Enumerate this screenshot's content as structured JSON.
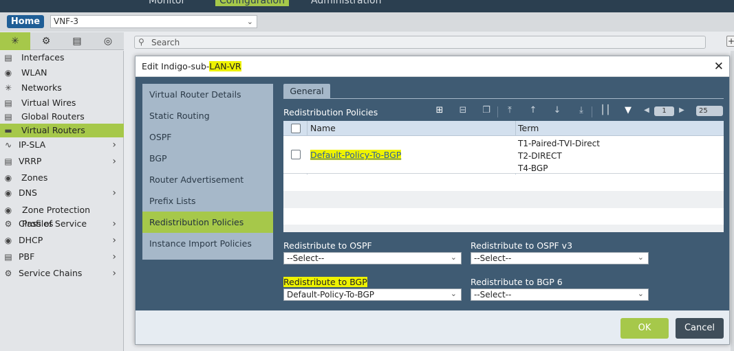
{
  "topnav": {
    "monitor": "Monitor",
    "configuration": "Configuration",
    "administration": "Administration"
  },
  "homebar": {
    "home": "Home",
    "appliance": "VNF-3"
  },
  "sidebar": {
    "items": [
      {
        "label": "Interfaces",
        "icon": "interfaces-icon"
      },
      {
        "label": "WLAN",
        "icon": "wlan-icon"
      },
      {
        "label": "Networks",
        "icon": "networks-icon"
      },
      {
        "label": "Virtual Wires",
        "icon": "virtual-wires-icon"
      },
      {
        "label": "Global Routers",
        "icon": "global-routers-icon"
      },
      {
        "label": "Virtual Routers",
        "icon": "virtual-routers-icon"
      },
      {
        "label": "IP-SLA",
        "icon": "ip-sla-icon"
      },
      {
        "label": "VRRP",
        "icon": "vrrp-icon"
      },
      {
        "label": "Zones",
        "icon": "zones-icon"
      },
      {
        "label": "DNS",
        "icon": "dns-icon"
      },
      {
        "label": "Zone Protection Profiles",
        "icon": "zone-protection-icon"
      },
      {
        "label": "Class of Service",
        "icon": "class-of-service-icon"
      },
      {
        "label": "DHCP",
        "icon": "dhcp-icon"
      },
      {
        "label": "PBF",
        "icon": "pbf-icon"
      },
      {
        "label": "Service Chains",
        "icon": "service-chains-icon"
      }
    ]
  },
  "search": {
    "placeholder": "Search"
  },
  "modal": {
    "title_prefix": "Edit Indigo-sub-",
    "title_highlight": "LAN-VR",
    "nav": [
      "Virtual Router Details",
      "Static Routing",
      "OSPF",
      "BGP",
      "Router Advertisement",
      "Prefix Lists",
      "Redistribution Policies",
      "Instance Import Policies"
    ],
    "tab_general": "General",
    "section_title": "Redistribution Policies",
    "pagination": {
      "page": "1",
      "page_size": "25"
    },
    "table": {
      "col_name": "Name",
      "col_term": "Term",
      "rows": [
        {
          "name": "Default-Policy-To-BGP",
          "terms": [
            "T1-Paired-TVI-Direct",
            "T2-DIRECT",
            "T4-BGP"
          ]
        }
      ]
    },
    "fields": {
      "ospf_label": "Redistribute to OSPF",
      "ospf_value": "--Select--",
      "ospfv3_label": "Redistribute to OSPF v3",
      "ospfv3_value": "--Select--",
      "bgp_label": "Redistribute to BGP",
      "bgp_value": "Default-Policy-To-BGP",
      "bgp6_label": "Redistribute to BGP 6",
      "bgp6_value": "--Select--"
    },
    "ok": "OK",
    "cancel": "Cancel"
  },
  "colors": {
    "accent": "#a6c84a",
    "highlight": "#eef200",
    "panel": "#3f5b73",
    "nav_bg": "#a6b8c9"
  }
}
